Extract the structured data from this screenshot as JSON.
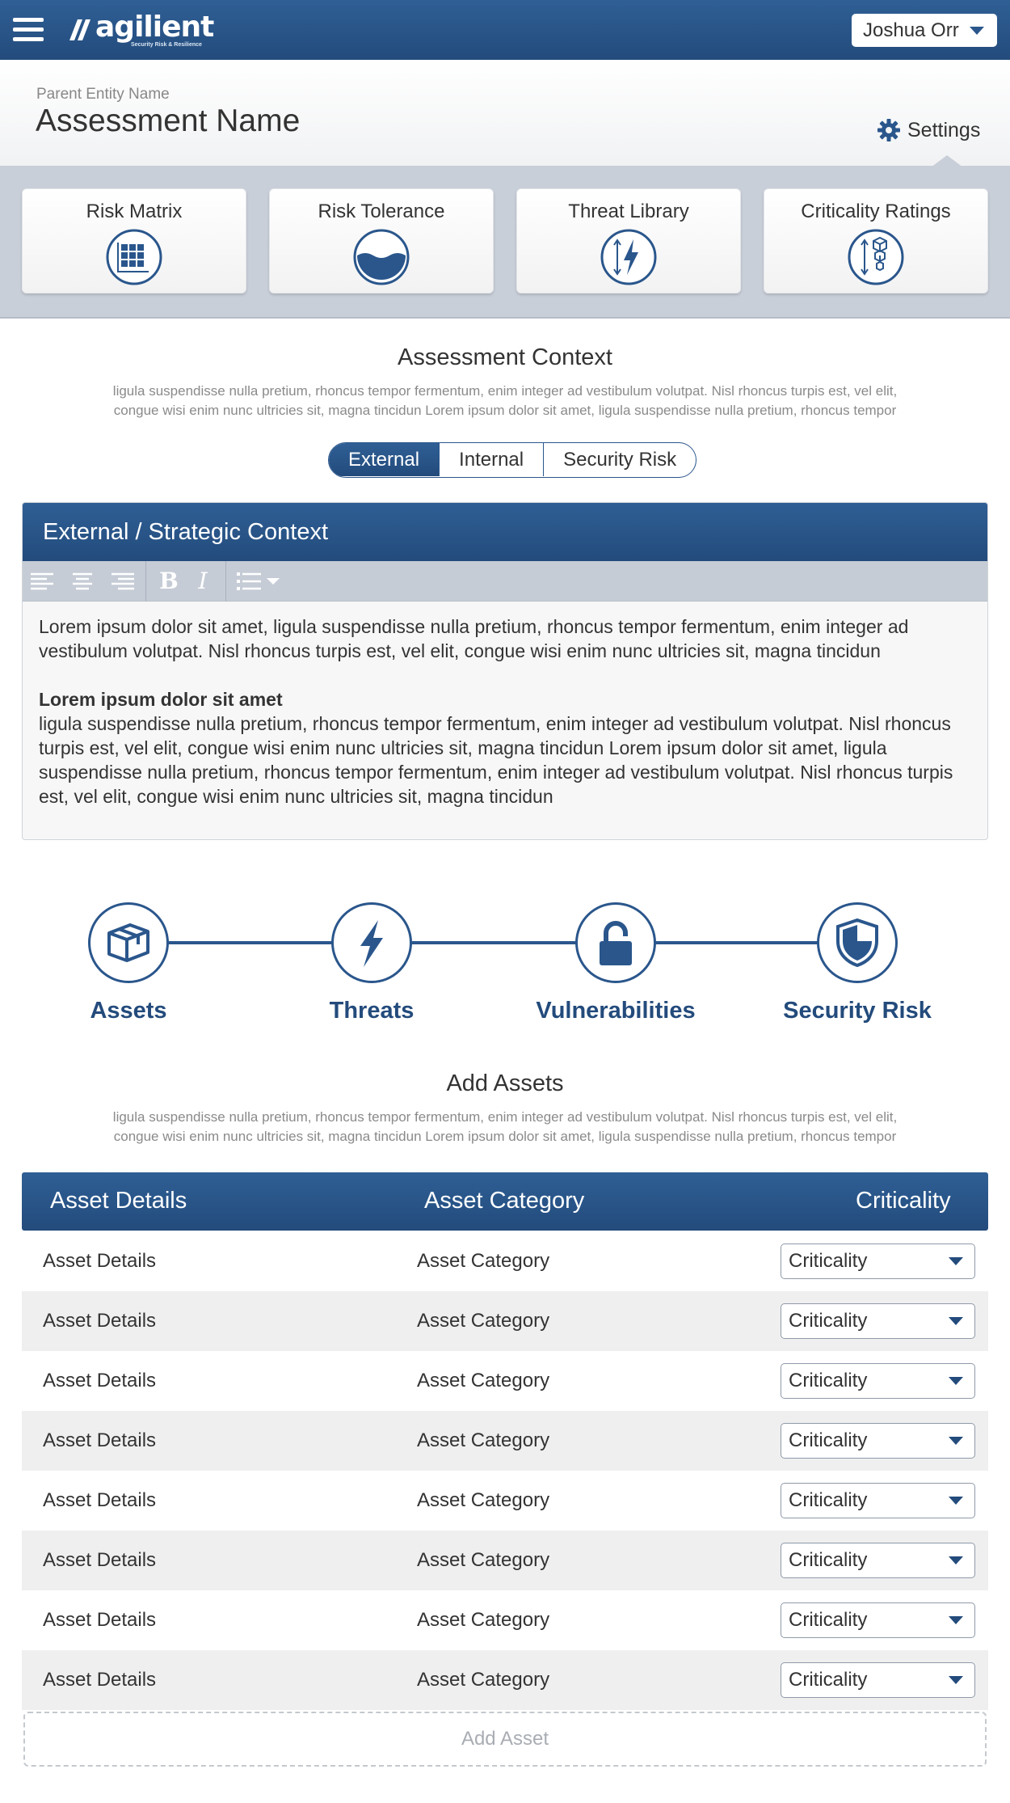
{
  "topbar": {
    "logo_text": "agilient",
    "logo_tagline": "Security Risk & Resilience",
    "user_name": "Joshua Orr"
  },
  "header": {
    "parent_entity": "Parent Entity Name",
    "assessment_name": "Assessment Name",
    "settings_label": "Settings"
  },
  "cards": [
    {
      "label": "Risk Matrix",
      "icon": "grid-icon"
    },
    {
      "label": "Risk Tolerance",
      "icon": "water-level-icon"
    },
    {
      "label": "Threat Library",
      "icon": "lightning-icon"
    },
    {
      "label": "Criticality Ratings",
      "icon": "stacked-boxes-icon"
    }
  ],
  "context": {
    "title": "Assessment Context",
    "desc_line1": "ligula suspendisse nulla pretium, rhoncus tempor fermentum, enim integer ad vestibulum volutpat. Nisl rhoncus turpis est, vel elit,",
    "desc_line2": "congue wisi enim nunc ultricies sit, magna tincidun Lorem ipsum dolor sit amet, ligula suspendisse nulla pretium, rhoncus tempor",
    "tabs": [
      "External",
      "Internal",
      "Security Risk"
    ],
    "active_tab": "External"
  },
  "editor": {
    "title": "External / Strategic Context",
    "para1": "Lorem ipsum dolor sit amet, ligula suspendisse nulla pretium, rhoncus tempor fermentum, enim integer ad vestibulum volutpat. Nisl rhoncus turpis est, vel elit, congue wisi enim nunc ultricies sit, magna tincidun",
    "bold_heading": "Lorem ipsum dolor sit amet",
    "para2": "ligula suspendisse nulla pretium, rhoncus tempor fermentum, enim integer ad vestibulum volutpat. Nisl rhoncus turpis est, vel elit, congue wisi enim nunc ultricies sit, magna tincidun Lorem ipsum dolor sit amet, ligula suspendisse nulla pretium, rhoncus tempor fermentum, enim integer ad vestibulum volutpat. Nisl rhoncus turpis est, vel elit, congue wisi enim nunc ultricies sit, magna tincidun",
    "toolbar": {
      "bold": "B",
      "italic": "I"
    }
  },
  "steps": [
    {
      "label": "Assets",
      "icon": "box-icon"
    },
    {
      "label": "Threats",
      "icon": "lightning-icon"
    },
    {
      "label": "Vulnerabilities",
      "icon": "padlock-icon"
    },
    {
      "label": "Security Risk",
      "icon": "shield-icon"
    }
  ],
  "assets": {
    "title": "Add Assets",
    "desc_line1": "ligula suspendisse nulla pretium, rhoncus tempor fermentum, enim integer ad vestibulum volutpat. Nisl rhoncus turpis est, vel elit,",
    "desc_line2": "congue wisi enim nunc ultricies sit, magna tincidun Lorem ipsum dolor sit amet, ligula suspendisse nulla pretium, rhoncus tempor",
    "columns": [
      "Asset Details",
      "Asset Category",
      "Criticality"
    ],
    "rows": [
      {
        "details": "Asset Details",
        "category": "Asset Category",
        "criticality": "Criticality"
      },
      {
        "details": "Asset Details",
        "category": "Asset Category",
        "criticality": "Criticality"
      },
      {
        "details": "Asset Details",
        "category": "Asset Category",
        "criticality": "Criticality"
      },
      {
        "details": "Asset Details",
        "category": "Asset Category",
        "criticality": "Criticality"
      },
      {
        "details": "Asset Details",
        "category": "Asset Category",
        "criticality": "Criticality"
      },
      {
        "details": "Asset Details",
        "category": "Asset Category",
        "criticality": "Criticality"
      },
      {
        "details": "Asset Details",
        "category": "Asset Category",
        "criticality": "Criticality"
      },
      {
        "details": "Asset Details",
        "category": "Asset Category",
        "criticality": "Criticality"
      }
    ],
    "add_label": "Add Asset"
  },
  "colors": {
    "primary": "#2a568c",
    "primary_dark": "#234b7c",
    "card_bar": "#c9cfd9",
    "row_alt": "#efefef"
  }
}
